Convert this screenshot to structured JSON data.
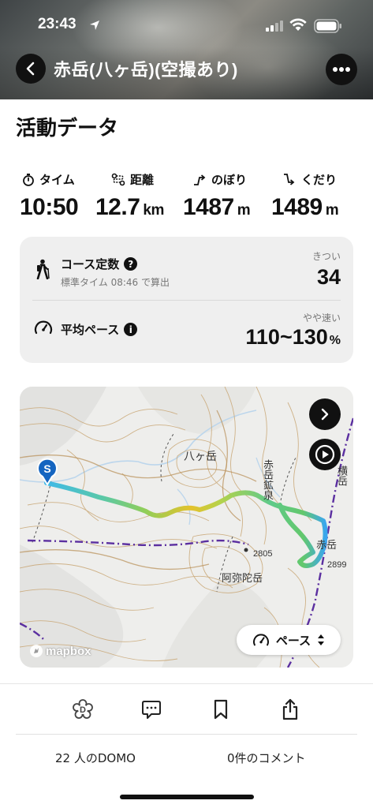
{
  "status": {
    "time": "23:43"
  },
  "header": {
    "title": "赤岳(八ヶ岳)(空撮あり)"
  },
  "section_title": "活動データ",
  "stats": [
    {
      "label": "タイム",
      "value": "10:50",
      "unit": ""
    },
    {
      "label": "距離",
      "value": "12.7",
      "unit": "km"
    },
    {
      "label": "のぼり",
      "value": "1487",
      "unit": "m"
    },
    {
      "label": "くだり",
      "value": "1489",
      "unit": "m"
    }
  ],
  "card": {
    "course": {
      "title": "コース定数",
      "sub": "標準タイム 08:46 で算出",
      "rating": "きつい",
      "value": "34"
    },
    "pace": {
      "title": "平均ペース",
      "rating": "やや速い",
      "value": "110~130",
      "unit": "%"
    }
  },
  "map": {
    "start_marker": "S",
    "labels": {
      "yatsugatake": "八ヶ岳",
      "akadake_kosen": "赤岳鉱泉",
      "yokodake": "横岳",
      "akadake": "赤岳",
      "amidadake": "阿弥陀岳",
      "elev_2805": "2805",
      "elev_2899": "2899"
    },
    "pace_button": "ペース",
    "attribution": "mapbox"
  },
  "bottom": {
    "domo": "22 人のDOMO",
    "comments": "0件のコメント"
  }
}
